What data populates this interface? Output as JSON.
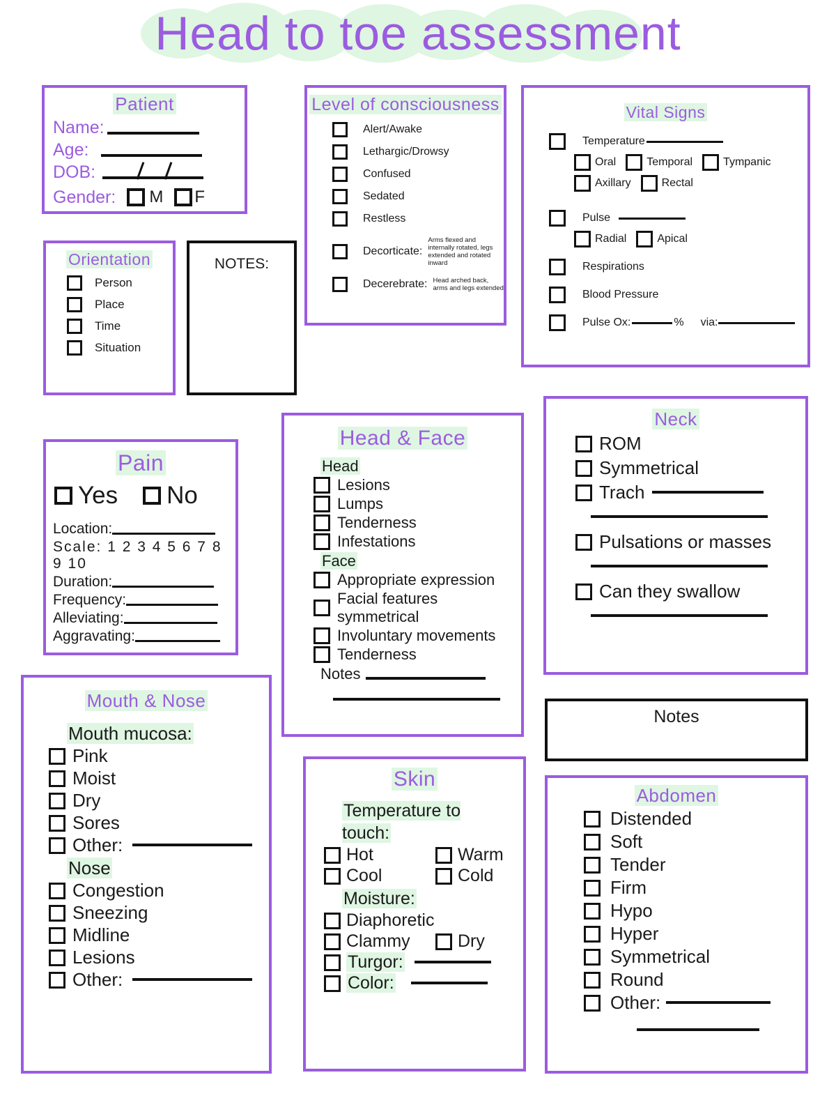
{
  "title": "Head to toe assessment",
  "patient": {
    "header": "Patient",
    "fields": [
      {
        "label": "Name:",
        "line": 130
      },
      {
        "label": "Age:",
        "line": 140
      },
      {
        "label": "DOB:",
        "line": 140
      },
      {
        "label": "Gender:"
      }
    ],
    "gender_options": [
      "M",
      "F"
    ]
  },
  "orientation": {
    "header": "Orientation",
    "items": [
      "Person",
      "Place",
      "Time",
      "Situation"
    ]
  },
  "notes_small": {
    "header": "NOTES:"
  },
  "level_of_consciousness": {
    "header": "Level of consciousness",
    "items": [
      {
        "label": "Alert/Awake",
        "desc": ""
      },
      {
        "label": "Lethargic/Drowsy",
        "desc": ""
      },
      {
        "label": "Confused",
        "desc": ""
      },
      {
        "label": "Sedated",
        "desc": ""
      },
      {
        "label": "Restless",
        "desc": ""
      },
      {
        "label": "Decorticate:",
        "desc": "Arms flexed and internally rotated, legs extended and rotated inward"
      },
      {
        "label": "Decerebrate:",
        "desc": "Head arched back, arms and legs extended"
      }
    ]
  },
  "vital_signs": {
    "header": "Vital Signs",
    "temperature_label": "Temperature",
    "temperature_routes_row1": [
      "Oral",
      "Temporal",
      "Tympanic"
    ],
    "temperature_routes_row2": [
      "Axillary",
      "Rectal"
    ],
    "pulse_label": "Pulse",
    "pulse_sites": [
      "Radial",
      "Apical"
    ],
    "respirations_label": "Respirations",
    "blood_pressure_label": "Blood Pressure",
    "pulse_ox_label": "Pulse Ox:",
    "pulse_ox_unit": "%",
    "pulse_ox_via": "via:"
  },
  "pain": {
    "header": "Pain",
    "yes": "Yes",
    "no": "No",
    "location_label": "Location:",
    "scale_label": "Scale:",
    "scale_values": "1 2 3 4 5 6 7 8 9 10",
    "duration_label": "Duration:",
    "frequency_label": "Frequency:",
    "alleviating_label": "Alleviating:",
    "aggravating_label": "Aggravating:"
  },
  "head_face": {
    "header": "Head & Face",
    "head_subheader": "Head",
    "head_items": [
      "Lesions",
      "Lumps",
      "Tenderness",
      "Infestations"
    ],
    "face_subheader": "Face",
    "face_items": [
      "Appropriate expression",
      "Facial features symmetrical",
      "Involuntary movements",
      "Tenderness"
    ],
    "notes_label": "Notes"
  },
  "neck": {
    "header": "Neck",
    "items": [
      "ROM",
      "Symmetrical",
      "Trach"
    ],
    "pulsations_label": "Pulsations or masses",
    "swallow_label": "Can they swallow"
  },
  "notes_right": {
    "header": "Notes"
  },
  "mouth_nose": {
    "header": "Mouth & Nose",
    "mucosa_subheader": "Mouth mucosa:",
    "mucosa_items": [
      "Pink",
      "Moist",
      "Dry",
      "Sores"
    ],
    "mucosa_other": "Other:",
    "nose_subheader": "Nose",
    "nose_items": [
      "Congestion",
      "Sneezing",
      "Midline",
      "Lesions"
    ],
    "nose_other": "Other:"
  },
  "skin": {
    "header": "Skin",
    "temp_subheader": "Temperature to touch:",
    "temp_row1": [
      "Hot",
      "Warm"
    ],
    "temp_row2": [
      "Cool",
      "Cold"
    ],
    "moisture_subheader": "Moisture:",
    "diaphoretic": "Diaphoretic",
    "clammy": "Clammy",
    "dry": "Dry",
    "turgor": "Turgor:",
    "color": "Color:"
  },
  "abdomen": {
    "header": "Abdomen",
    "items": [
      "Distended",
      "Soft",
      "Tender",
      "Firm",
      "Hypo",
      "Hyper",
      "Symmetrical",
      "Round"
    ],
    "other": "Other:"
  },
  "colors": {
    "accent_purple": "#9B5CE0",
    "highlight_mint": "#DFF6E2",
    "ink_black": "#111111"
  }
}
